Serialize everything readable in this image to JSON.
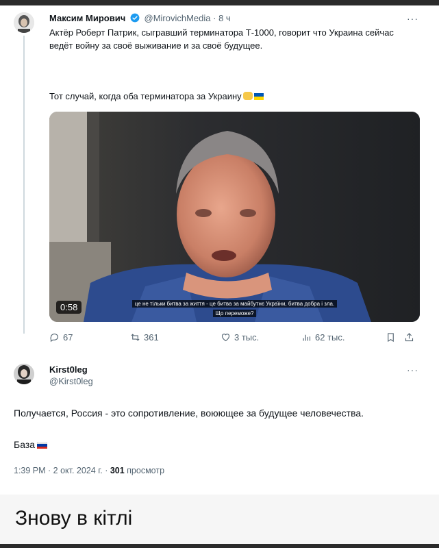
{
  "tweet1": {
    "author_name": "Максим Мирович",
    "handle": "@MirovichMedia",
    "separator": "·",
    "time": "8 ч",
    "text": "Актёр Роберт Патрик, сыгравший терминатора Т-1000, говорит что Украина сейчас ведёт войну за своё выживание и за своё будущее.",
    "text2": "Тот случай, когда оба терминатора за Украину",
    "video": {
      "duration": "0:58",
      "subtitle_line1": "це не тільки битва за життя - це битва за майбутнє України, битва добра і зла.",
      "subtitle_line2": "Що переможе?"
    },
    "actions": {
      "replies": "67",
      "reposts": "361",
      "likes": "3 тыс.",
      "views": "62 тыс."
    },
    "icons": [
      "verified-icon",
      "more-icon",
      "reply-icon",
      "repost-icon",
      "like-icon",
      "views-icon",
      "bookmark-icon",
      "share-icon"
    ]
  },
  "tweet2": {
    "author_name": "Kirst0leg",
    "handle": "@Kirst0leg",
    "text": "Получается, Россия - это сопротивление, воюющее за будущее человечества.",
    "text2": "База",
    "time": "1:39 PM · 2 окт. 2024 г. · ",
    "views_count": "301",
    "views_label": " просмотр"
  },
  "caption": "Знову в кітлі",
  "colors": {
    "verified": "#1d9bf0",
    "muted_text": "#536471",
    "text": "#0f1419",
    "ua_blue": "#0057b7",
    "ua_yellow": "#ffd700"
  }
}
